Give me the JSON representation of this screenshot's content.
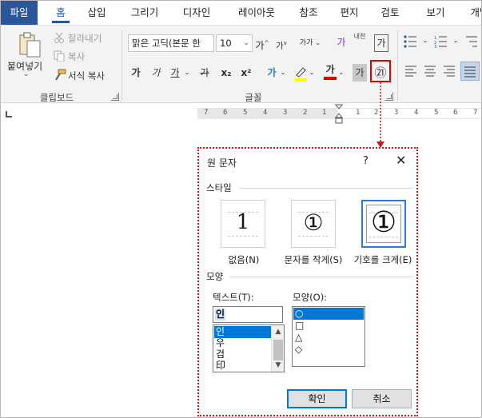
{
  "tabs": [
    "파일",
    "홈",
    "삽입",
    "그리기",
    "디자인",
    "레이아웃",
    "참조",
    "편지",
    "검토",
    "보기",
    "개발"
  ],
  "clipboard": {
    "paste_label": "붙여넣기",
    "cut_label": "잘라내기",
    "copy_label": "복사",
    "format_painter_label": "서식 복사",
    "group_label": "클립보드"
  },
  "font": {
    "font_name": "맑은 고딕(본문 한",
    "font_size": "10",
    "grow_label": "가",
    "shrink_label": "가",
    "case_label": "가가",
    "clear_label": "가",
    "phonetic_label": "내천",
    "charborder_label": "가",
    "bold_label": "가",
    "italic_label": "가",
    "underline_label": "가",
    "strike_label": "가",
    "subscript_label": "x₂",
    "superscript_label": "x²",
    "effects_label": "가",
    "fontcolor_label": "가",
    "shading_label": "가",
    "enclose_label": "㉑",
    "group_label": "글꼴",
    "colors": {
      "highlight": "#ffff00",
      "font_color": "#e00000",
      "effect": "#2b7cd3"
    }
  },
  "ruler": {
    "numbers": [
      "7",
      "6",
      "5",
      "4",
      "3",
      "2",
      "1",
      "1",
      "2",
      "3",
      "4",
      "5",
      "6",
      "7"
    ]
  },
  "dialog": {
    "title": "원 문자",
    "help": "?",
    "close": "✕",
    "style_section": "스타일",
    "styles": [
      {
        "glyph": "1",
        "name": "없음(N)"
      },
      {
        "glyph": "①",
        "name": "문자를 작게(S)"
      },
      {
        "glyph": "①",
        "name": "기호를 크게(E)"
      }
    ],
    "shape_section": "모양",
    "text_label": "텍스트(T):",
    "text_value": "인",
    "text_list": [
      "인",
      "우",
      "검",
      "印"
    ],
    "shape_label": "모양(O):",
    "shape_list": [
      "○",
      "□",
      "△",
      "◇"
    ],
    "ok_label": "확인",
    "cancel_label": "취소"
  }
}
